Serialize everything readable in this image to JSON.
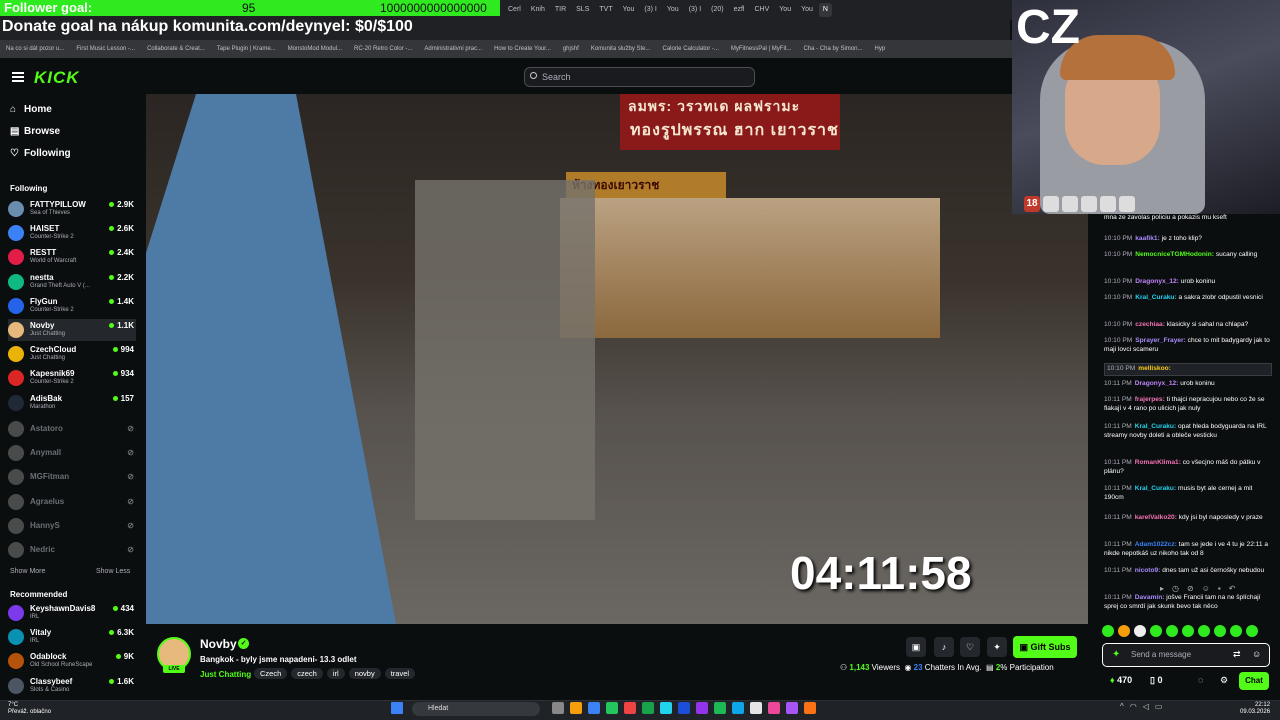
{
  "overlay": {
    "follower_goal_label": "Follower goal:",
    "follower_goal_count": "95",
    "follower_goal_target": "1000000000000000",
    "donate_goal": "Donate goal na nákup komunita.com/deynyel: $0/$100",
    "timer": "04:11:58",
    "webcam_label": "CZ",
    "webcam_badge": "18"
  },
  "browser": {
    "tabs": [
      "Cerl",
      "Knih",
      "TIR",
      "SLS",
      "TVT",
      "You",
      "(3) I",
      "You",
      "(3) I",
      "(20)",
      "ezfl",
      "CHV",
      "You",
      "You",
      "N"
    ],
    "bookmarks": [
      "Na co si dát pozor u...",
      "First Music Lesson -...",
      "Collaborate & Creat...",
      "Tape Plugin | Krame...",
      "MonstoMod Modul...",
      "RC-20 Retro Color -...",
      "Administrativní prac...",
      "How to Create Your...",
      "ghjshf",
      "Komunita služby Ste...",
      "Calorie Calculator -...",
      "MyFitnessPal | MyFit...",
      "Cha - Cha by Simon...",
      "Hyp"
    ]
  },
  "kick": {
    "logo": "KICK",
    "search_placeholder": "Search"
  },
  "sidebar": {
    "nav": [
      {
        "label": "Home",
        "icon": "home-icon"
      },
      {
        "label": "Browse",
        "icon": "browse-icon"
      },
      {
        "label": "Following",
        "icon": "heart-icon"
      }
    ],
    "following_title": "Following",
    "channels": [
      {
        "name": "FATTYPILLOW",
        "game": "Sea of Thieves",
        "viewers": "2.9K",
        "color": "#6a8caf"
      },
      {
        "name": "HAISET",
        "game": "Counter-Strike 2",
        "viewers": "2.6K",
        "color": "#3b82f6"
      },
      {
        "name": "RESTT",
        "game": "World of Warcraft",
        "viewers": "2.4K",
        "color": "#e11d48"
      },
      {
        "name": "nestta",
        "game": "Grand Theft Auto V (...",
        "viewers": "2.2K",
        "color": "#10b981"
      },
      {
        "name": "FlyGun",
        "game": "Counter-Strike 2",
        "viewers": "1.4K",
        "color": "#2563eb"
      },
      {
        "name": "Novby",
        "game": "Just Chatting",
        "viewers": "1.1K",
        "color": "#e7b97c"
      },
      {
        "name": "CzechCloud",
        "game": "Just Chatting",
        "viewers": "994",
        "color": "#eab308"
      },
      {
        "name": "Kapesnik69",
        "game": "Counter-Strike 2",
        "viewers": "934",
        "color": "#dc2626"
      },
      {
        "name": "AdisBak",
        "game": "Marathon",
        "viewers": "157",
        "color": "#1f2937"
      }
    ],
    "offline_channels": [
      "Astatoro",
      "Anymall",
      "MGFitman",
      "Agraelus",
      "HannyS",
      "Nedric"
    ],
    "show_more": "Show More",
    "show_less": "Show Less",
    "recommended_title": "Recommended",
    "recommended": [
      {
        "name": "KeyshawnDavis8",
        "game": "IRL",
        "viewers": "434",
        "color": "#7c3aed"
      },
      {
        "name": "Vitaly",
        "game": "IRL",
        "viewers": "6.3K",
        "color": "#0891b2"
      },
      {
        "name": "Odablock",
        "game": "Old School RuneScape",
        "viewers": "9K",
        "color": "#b45309"
      },
      {
        "name": "Classybeef",
        "game": "Slots & Casino",
        "viewers": "1.6K",
        "color": "#4b5563"
      }
    ]
  },
  "video": {
    "sign_line1": "ลมพร: วรวทเด ผลฟรามะ",
    "sign_line2": "ทองรูปพรรณ ฮาก เยาวราช",
    "sign_line3": "ห้างทองเยาวราช"
  },
  "stream": {
    "name": "Novby",
    "live": "LIVE",
    "title": "Bangkok - byly jsme napadeni- 13.3 odlet",
    "category": "Just Chatting",
    "tags": [
      "Czech",
      "czech",
      "irl",
      "novby",
      "travel"
    ],
    "gift_subs": "Gift Subs",
    "viewers": "1,143",
    "viewers_label": "Viewers",
    "chatters": "23",
    "chatters_label": "Chatters In Avg.",
    "participation": "2",
    "participation_label": "% Participation"
  },
  "chat": {
    "messages": [
      {
        "time": "",
        "user": "",
        "text": "mna ze zavolas policiu a pokazis mu kseft",
        "color": "#fff"
      },
      {
        "time": "10:10 PM",
        "user": "kaafik1:",
        "text": "je z toho klip?",
        "color": "#a78bfa"
      },
      {
        "time": "10:10 PM",
        "user": "NemocniceTGMHodonin:",
        "text": "sucany calling",
        "color": "#53fc18"
      },
      {
        "time": "10:10 PM",
        "user": "Dragonyx_12:",
        "text": "urob koninu",
        "color": "#c084fc"
      },
      {
        "time": "10:10 PM",
        "user": "Kral_Curaku:",
        "text": "a sakra zlobr odpustil vesnici",
        "color": "#22d3ee"
      },
      {
        "time": "10:10 PM",
        "user": "czechiaa:",
        "text": "klasicky si sahal na chlapa?",
        "color": "#f472b6"
      },
      {
        "time": "10:10 PM",
        "user": "Sprayer_Frayer:",
        "text": "chce to mit badygardy jak to maji lovci scameru",
        "color": "#a78bfa"
      },
      {
        "time": "10:10 PM",
        "user": "melliskoo:",
        "text": "",
        "color": "#facc15"
      },
      {
        "time": "10:11 PM",
        "user": "Dragonyx_12:",
        "text": "urob koninu",
        "color": "#c084fc"
      },
      {
        "time": "10:11 PM",
        "user": "frajerpes:",
        "text": "ti thajci nepracujou nebo co že se flakají v 4 rano po ulicich jak nuly",
        "color": "#f472b6"
      },
      {
        "time": "10:11 PM",
        "user": "Kral_Curaku:",
        "text": "opat hleda bodyguarda na IRL streamy novby doleti a obleče vesticku",
        "color": "#22d3ee"
      },
      {
        "time": "10:11 PM",
        "user": "RomanKlima1:",
        "text": "co všecjno máš do pátku v plánu?",
        "color": "#f472b6"
      },
      {
        "time": "10:11 PM",
        "user": "Kral_Curaku:",
        "text": "musis byt ale cernej a mit 190cm",
        "color": "#22d3ee"
      },
      {
        "time": "10:11 PM",
        "user": "karelValko20:",
        "text": "kdy jsi byl naposledy v praze",
        "color": "#f472b6"
      },
      {
        "time": "10:11 PM",
        "user": "Adam1022cz:",
        "text": "tam se jede i ve 4 tu je 22:11 a nikde nepotkáš uz nikoho tak od 8",
        "color": "#3b82f6"
      },
      {
        "time": "10:11 PM",
        "user": "nicoto9:",
        "text": "dnes tam už asi černošky nebudou",
        "color": "#a78bfa"
      },
      {
        "time": "10:11 PM",
        "user": "Davamin:",
        "text": "jošve Francii tam na ne šplíchají sprej co smrdí jak skunk bevo tak něco",
        "color": "#a78bfa"
      }
    ],
    "input_placeholder": "Send a message",
    "points": "470",
    "zero": "0",
    "chat_button": "Chat"
  },
  "taskbar": {
    "weather_temp": "7°C",
    "weather_desc": "Převáž. oblačno",
    "search_placeholder": "Hledat",
    "time": "22:12",
    "date": "09.03.2026",
    "app_colors": [
      "#888",
      "#f59e0b",
      "#3b82f6",
      "#22c55e",
      "#ef4444",
      "#16a34a",
      "#22d3ee",
      "#1d4ed8",
      "#9333ea",
      "#1db954",
      "#0ea5e9",
      "#e5e5e5",
      "#ec4899",
      "#a855f7",
      "#f97316"
    ]
  }
}
